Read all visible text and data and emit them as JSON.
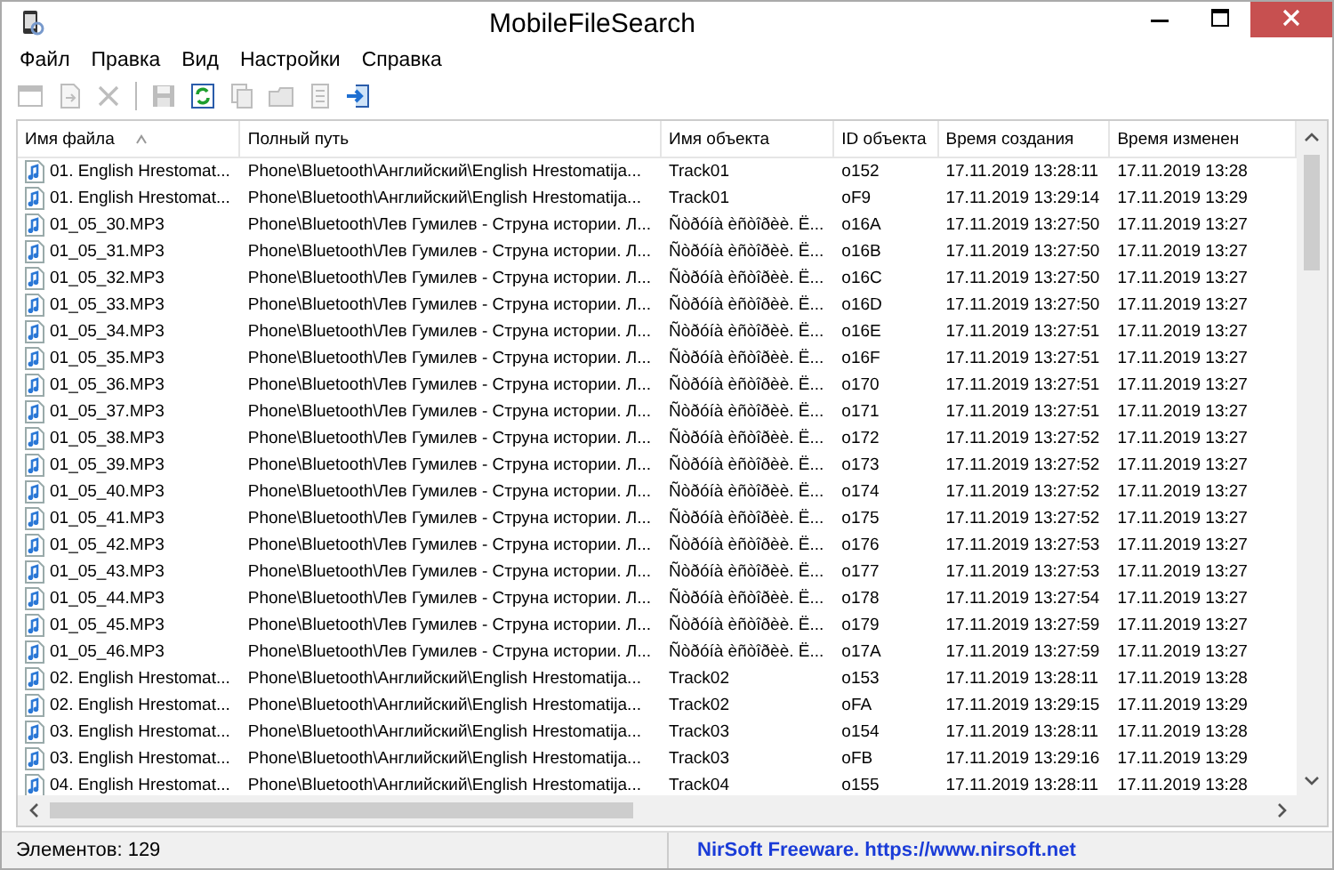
{
  "window": {
    "title": "MobileFileSearch"
  },
  "menu": [
    "Файл",
    "Правка",
    "Вид",
    "Настройки",
    "Справка"
  ],
  "toolbar": [
    {
      "kind": "properties",
      "disabled": true
    },
    {
      "kind": "document",
      "disabled": true
    },
    {
      "kind": "delete",
      "disabled": true
    },
    {
      "kind": "separator"
    },
    {
      "kind": "save",
      "disabled": true
    },
    {
      "kind": "refresh",
      "disabled": false
    },
    {
      "kind": "copy",
      "disabled": true
    },
    {
      "kind": "folder",
      "disabled": true
    },
    {
      "kind": "report",
      "disabled": true
    },
    {
      "kind": "exit",
      "disabled": false
    }
  ],
  "table": {
    "columns": [
      {
        "label": "Имя файла",
        "sorted": true
      },
      {
        "label": "Полный путь",
        "sorted": false
      },
      {
        "label": "Имя объекта",
        "sorted": false
      },
      {
        "label": "ID объекта",
        "sorted": false
      },
      {
        "label": "Время создания",
        "sorted": false
      },
      {
        "label": "Время изменен",
        "sorted": false
      }
    ],
    "rows": [
      {
        "name": "01. English Hrestomat...",
        "path": "Phone\\Bluetooth\\Английский\\English Hrestomatija...",
        "object": "Track01",
        "id": "o152",
        "created": "17.11.2019 13:28:11",
        "modified": "17.11.2019 13:28"
      },
      {
        "name": "01. English Hrestomat...",
        "path": "Phone\\Bluetooth\\Английский\\English Hrestomatija...",
        "object": "Track01",
        "id": "oF9",
        "created": "17.11.2019 13:29:14",
        "modified": "17.11.2019 13:29"
      },
      {
        "name": "01_05_30.MP3",
        "path": "Phone\\Bluetooth\\Лев Гумилев - Струна истории. Л...",
        "object": "Ñòðóíà èñòîðèè. Ë...",
        "id": "o16A",
        "created": "17.11.2019 13:27:50",
        "modified": "17.11.2019 13:27"
      },
      {
        "name": "01_05_31.MP3",
        "path": "Phone\\Bluetooth\\Лев Гумилев - Струна истории. Л...",
        "object": "Ñòðóíà èñòîðèè. Ë...",
        "id": "o16B",
        "created": "17.11.2019 13:27:50",
        "modified": "17.11.2019 13:27"
      },
      {
        "name": "01_05_32.MP3",
        "path": "Phone\\Bluetooth\\Лев Гумилев - Струна истории. Л...",
        "object": "Ñòðóíà èñòîðèè. Ë...",
        "id": "o16C",
        "created": "17.11.2019 13:27:50",
        "modified": "17.11.2019 13:27"
      },
      {
        "name": "01_05_33.MP3",
        "path": "Phone\\Bluetooth\\Лев Гумилев - Струна истории. Л...",
        "object": "Ñòðóíà èñòîðèè. Ë...",
        "id": "o16D",
        "created": "17.11.2019 13:27:50",
        "modified": "17.11.2019 13:27"
      },
      {
        "name": "01_05_34.MP3",
        "path": "Phone\\Bluetooth\\Лев Гумилев - Струна истории. Л...",
        "object": "Ñòðóíà èñòîðèè. Ë...",
        "id": "o16E",
        "created": "17.11.2019 13:27:51",
        "modified": "17.11.2019 13:27"
      },
      {
        "name": "01_05_35.MP3",
        "path": "Phone\\Bluetooth\\Лев Гумилев - Струна истории. Л...",
        "object": "Ñòðóíà èñòîðèè. Ë...",
        "id": "o16F",
        "created": "17.11.2019 13:27:51",
        "modified": "17.11.2019 13:27"
      },
      {
        "name": "01_05_36.MP3",
        "path": "Phone\\Bluetooth\\Лев Гумилев - Струна истории. Л...",
        "object": "Ñòðóíà èñòîðèè. Ë...",
        "id": "o170",
        "created": "17.11.2019 13:27:51",
        "modified": "17.11.2019 13:27"
      },
      {
        "name": "01_05_37.MP3",
        "path": "Phone\\Bluetooth\\Лев Гумилев - Струна истории. Л...",
        "object": "Ñòðóíà èñòîðèè. Ë...",
        "id": "o171",
        "created": "17.11.2019 13:27:51",
        "modified": "17.11.2019 13:27"
      },
      {
        "name": "01_05_38.MP3",
        "path": "Phone\\Bluetooth\\Лев Гумилев - Струна истории. Л...",
        "object": "Ñòðóíà èñòîðèè. Ë...",
        "id": "o172",
        "created": "17.11.2019 13:27:52",
        "modified": "17.11.2019 13:27"
      },
      {
        "name": "01_05_39.MP3",
        "path": "Phone\\Bluetooth\\Лев Гумилев - Струна истории. Л...",
        "object": "Ñòðóíà èñòîðèè. Ë...",
        "id": "o173",
        "created": "17.11.2019 13:27:52",
        "modified": "17.11.2019 13:27"
      },
      {
        "name": "01_05_40.MP3",
        "path": "Phone\\Bluetooth\\Лев Гумилев - Струна истории. Л...",
        "object": "Ñòðóíà èñòîðèè. Ë...",
        "id": "o174",
        "created": "17.11.2019 13:27:52",
        "modified": "17.11.2019 13:27"
      },
      {
        "name": "01_05_41.MP3",
        "path": "Phone\\Bluetooth\\Лев Гумилев - Струна истории. Л...",
        "object": "Ñòðóíà èñòîðèè. Ë...",
        "id": "o175",
        "created": "17.11.2019 13:27:52",
        "modified": "17.11.2019 13:27"
      },
      {
        "name": "01_05_42.MP3",
        "path": "Phone\\Bluetooth\\Лев Гумилев - Струна истории. Л...",
        "object": "Ñòðóíà èñòîðèè. Ë...",
        "id": "o176",
        "created": "17.11.2019 13:27:53",
        "modified": "17.11.2019 13:27"
      },
      {
        "name": "01_05_43.MP3",
        "path": "Phone\\Bluetooth\\Лев Гумилев - Струна истории. Л...",
        "object": "Ñòðóíà èñòîðèè. Ë...",
        "id": "o177",
        "created": "17.11.2019 13:27:53",
        "modified": "17.11.2019 13:27"
      },
      {
        "name": "01_05_44.MP3",
        "path": "Phone\\Bluetooth\\Лев Гумилев - Струна истории. Л...",
        "object": "Ñòðóíà èñòîðèè. Ë...",
        "id": "o178",
        "created": "17.11.2019 13:27:54",
        "modified": "17.11.2019 13:27"
      },
      {
        "name": "01_05_45.MP3",
        "path": "Phone\\Bluetooth\\Лев Гумилев - Струна истории. Л...",
        "object": "Ñòðóíà èñòîðèè. Ë...",
        "id": "o179",
        "created": "17.11.2019 13:27:59",
        "modified": "17.11.2019 13:27"
      },
      {
        "name": "01_05_46.MP3",
        "path": "Phone\\Bluetooth\\Лев Гумилев - Струна истории. Л...",
        "object": "Ñòðóíà èñòîðèè. Ë...",
        "id": "o17A",
        "created": "17.11.2019 13:27:59",
        "modified": "17.11.2019 13:27"
      },
      {
        "name": "02. English Hrestomat...",
        "path": "Phone\\Bluetooth\\Английский\\English Hrestomatija...",
        "object": "Track02",
        "id": "o153",
        "created": "17.11.2019 13:28:11",
        "modified": "17.11.2019 13:28"
      },
      {
        "name": "02. English Hrestomat...",
        "path": "Phone\\Bluetooth\\Английский\\English Hrestomatija...",
        "object": "Track02",
        "id": "oFA",
        "created": "17.11.2019 13:29:15",
        "modified": "17.11.2019 13:29"
      },
      {
        "name": "03. English Hrestomat...",
        "path": "Phone\\Bluetooth\\Английский\\English Hrestomatija...",
        "object": "Track03",
        "id": "o154",
        "created": "17.11.2019 13:28:11",
        "modified": "17.11.2019 13:28"
      },
      {
        "name": "03. English Hrestomat...",
        "path": "Phone\\Bluetooth\\Английский\\English Hrestomatija...",
        "object": "Track03",
        "id": "oFB",
        "created": "17.11.2019 13:29:16",
        "modified": "17.11.2019 13:29"
      },
      {
        "name": "04. English Hrestomat...",
        "path": "Phone\\Bluetooth\\Английский\\English Hrestomatija...",
        "object": "Track04",
        "id": "o155",
        "created": "17.11.2019 13:28:11",
        "modified": "17.11.2019 13:28"
      }
    ]
  },
  "status_bar": {
    "count": "Элементов: 129",
    "credit": "NirSoft Freeware. https://www.nirsoft.net"
  }
}
